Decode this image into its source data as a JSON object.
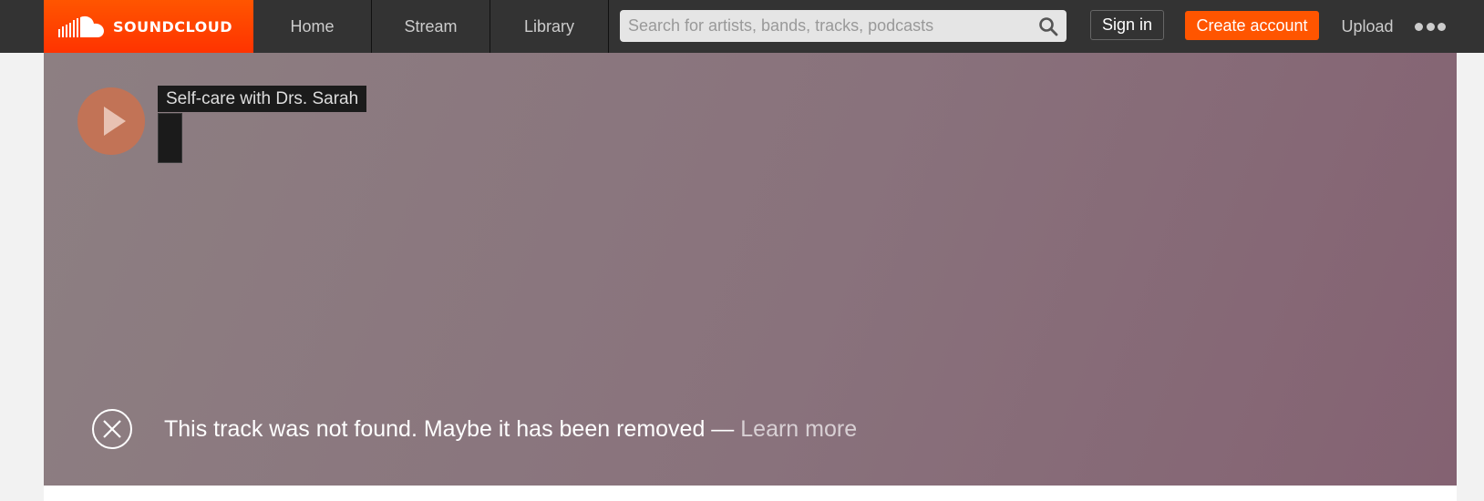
{
  "header": {
    "logo_text": "SOUNDCLOUD",
    "nav": {
      "home": "Home",
      "stream": "Stream",
      "library": "Library"
    },
    "search": {
      "placeholder": "Search for artists, bands, tracks, podcasts",
      "value": "",
      "icon": "search-icon"
    },
    "sign_in_label": "Sign in",
    "create_account_label": "Create account",
    "upload_label": "Upload",
    "more_icon": "more-icon"
  },
  "track": {
    "title": "Self-care with Drs. Sarah",
    "artist": "",
    "play_icon": "play-icon"
  },
  "error": {
    "icon": "close-circle-icon",
    "message": "This track was not found. Maybe it has been removed",
    "separator": " — ",
    "learn_more": "Learn more"
  },
  "colors": {
    "brand": "#ff5500",
    "header_bg": "#333333",
    "page_bg": "#f2f2f2",
    "play_button": "#c27356"
  }
}
